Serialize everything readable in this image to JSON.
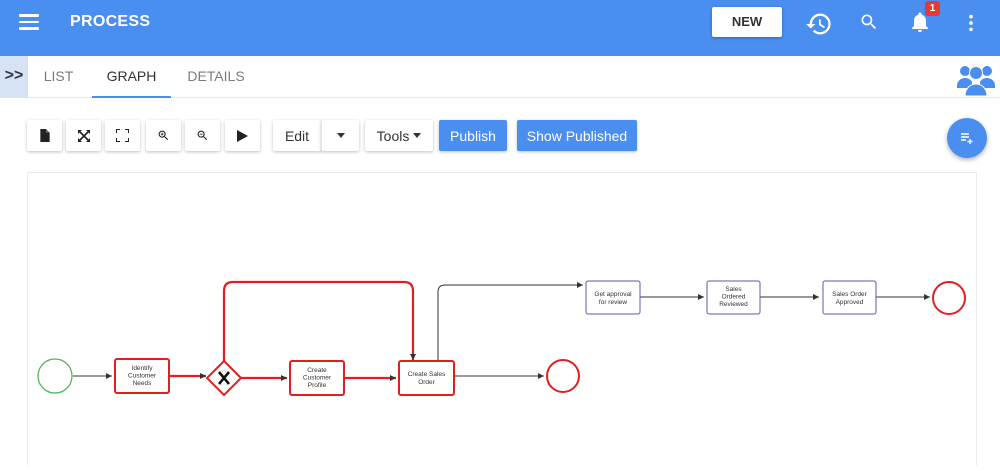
{
  "header": {
    "title": "PROCESS",
    "new_label": "NEW",
    "notification_count": "1",
    "icons": [
      "menu-icon",
      "history-icon",
      "search-icon",
      "bell-icon",
      "more-vert-icon"
    ]
  },
  "tabs": [
    {
      "label": "LIST",
      "active": false
    },
    {
      "label": "GRAPH",
      "active": true
    },
    {
      "label": "DETAILS",
      "active": false
    }
  ],
  "expand_label": ">>",
  "toolbar": {
    "icon_buttons": [
      "new-document-icon",
      "fit-icon",
      "fullscreen-icon",
      "zoom-in-icon",
      "zoom-out-icon",
      "play-icon"
    ],
    "edit_label": "Edit",
    "tools_label": "Tools",
    "publish_label": "Publish",
    "show_published_label": "Show Published"
  },
  "graph": {
    "nodes": [
      {
        "id": "start",
        "type": "start-event",
        "label": ""
      },
      {
        "id": "identify",
        "type": "task",
        "label": [
          "Identify",
          "Customer",
          "Needs"
        ],
        "highlighted": true
      },
      {
        "id": "gateway",
        "type": "exclusive-gateway",
        "label": "X",
        "highlighted": true
      },
      {
        "id": "create_profile",
        "type": "task",
        "label": [
          "Create",
          "Customer",
          "Profile"
        ],
        "highlighted": true
      },
      {
        "id": "create_order",
        "type": "task",
        "label": [
          "Create Sales",
          "Order"
        ],
        "highlighted": true
      },
      {
        "id": "end1",
        "type": "end-event",
        "label": ""
      },
      {
        "id": "approval",
        "type": "task",
        "label": [
          "Get approval",
          "for review"
        ],
        "highlighted": false
      },
      {
        "id": "reviewed",
        "type": "task",
        "label": [
          "Sales",
          "Ordered",
          "Reviewed"
        ],
        "highlighted": false
      },
      {
        "id": "approved",
        "type": "task",
        "label": [
          "Sales Order",
          "Approved"
        ],
        "highlighted": false
      },
      {
        "id": "end2",
        "type": "end-event",
        "label": ""
      }
    ],
    "colors": {
      "highlight": "#e02020",
      "start": "#4caf50",
      "task": "#5a5aa8",
      "edge": "#333333"
    }
  }
}
